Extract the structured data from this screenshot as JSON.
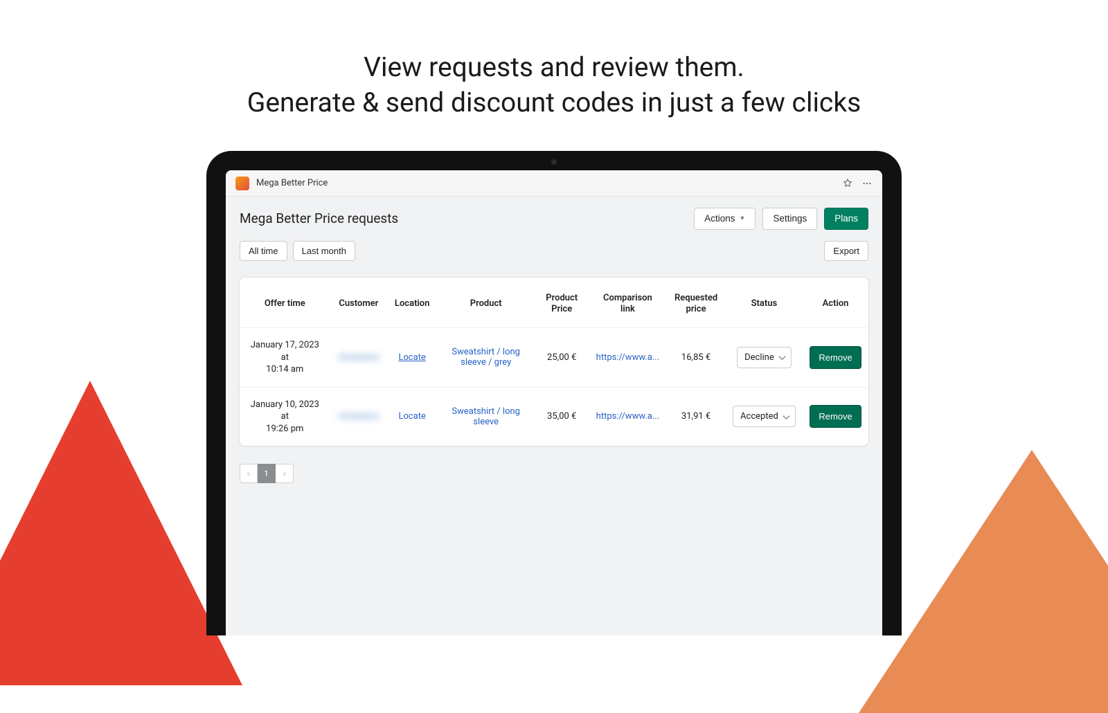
{
  "hero": {
    "line1": "View requests and review them.",
    "line2": "Generate & send discount codes in just a few clicks"
  },
  "app": {
    "name": "Mega Better Price"
  },
  "page": {
    "title": "Mega Better Price requests"
  },
  "header_actions": {
    "actions": "Actions",
    "settings": "Settings",
    "plans": "Plans"
  },
  "filters": {
    "all_time": "All time",
    "last_month": "Last month",
    "export": "Export"
  },
  "columns": {
    "offer_time": "Offer time",
    "customer": "Customer",
    "location": "Location",
    "product": "Product",
    "product_price": "Product Price",
    "comparison_link": "Comparison link",
    "requested_price": "Requested price",
    "status": "Status",
    "action": "Action"
  },
  "rows": [
    {
      "offer_time_line1": "January 17, 2023 at",
      "offer_time_line2": "10:14 am",
      "customer": "Anastasia",
      "locate": "Locate",
      "product": "Sweatshirt / long sleeve / grey",
      "product_price": "25,00 €",
      "comparison_link": "https://www.a...",
      "requested_price": "16,85 €",
      "status": "Decline",
      "remove": "Remove"
    },
    {
      "offer_time_line1": "January 10, 2023 at",
      "offer_time_line2": "19:26 pm",
      "customer": "Anastasia",
      "locate": "Locate",
      "product": "Sweatshirt / long sleeve",
      "product_price": "35,00 €",
      "comparison_link": "https://www.a...",
      "requested_price": "31,91 €",
      "status": "Accepted",
      "remove": "Remove"
    }
  ],
  "pagination": {
    "prev": "«",
    "page": "1",
    "next": "»"
  }
}
